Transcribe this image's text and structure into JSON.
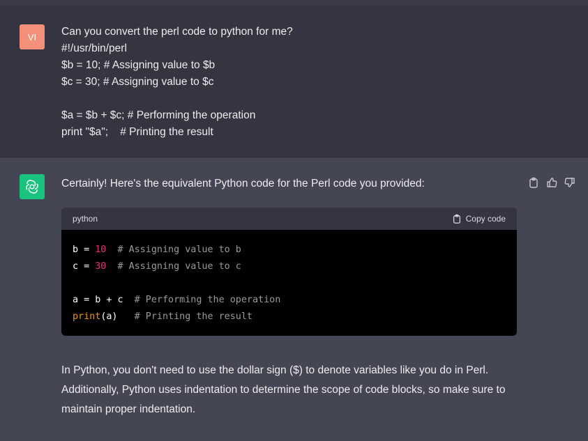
{
  "user": {
    "avatar_initials": "VI",
    "lines": [
      "Can you convert the perl code to python for me?",
      "#!/usr/bin/perl",
      "$b = 10; # Assigning value to $b",
      "$c = 30; # Assigning value to $c",
      "",
      "$a = $b + $c; # Performing the operation",
      "print \"$a\";    # Printing the result"
    ]
  },
  "assistant": {
    "avatar_icon": "openai-logo-icon",
    "intro": "Certainly! Here's the equivalent Python code for the Perl code you provided:",
    "code": {
      "language": "python",
      "copy_label": "Copy code",
      "line1": {
        "var": "b",
        "op": " = ",
        "num": "10",
        "comment": "  # Assigning value to b"
      },
      "line2": {
        "var": "c",
        "op": " = ",
        "num": "30",
        "comment": "  # Assigning value to c"
      },
      "line4": {
        "expr": "a = b + c",
        "comment": "  # Performing the operation"
      },
      "line5": {
        "fn": "print",
        "args": "(a)",
        "comment": "   # Printing the result"
      }
    },
    "outro": "In Python, you don't need to use the dollar sign ($) to denote variables like you do in Perl. Additionally, Python uses indentation to determine the scope of code blocks, so make sure to maintain proper indentation."
  },
  "actions": [
    "clipboard-icon",
    "thumbs-up-icon",
    "thumbs-down-icon"
  ],
  "colors": {
    "user_bg": "#343541",
    "assistant_bg": "#444654",
    "user_avatar": "#f4907a",
    "assistant_avatar": "#19c37d",
    "code_number": "#df3079",
    "code_function": "#e9950c"
  }
}
